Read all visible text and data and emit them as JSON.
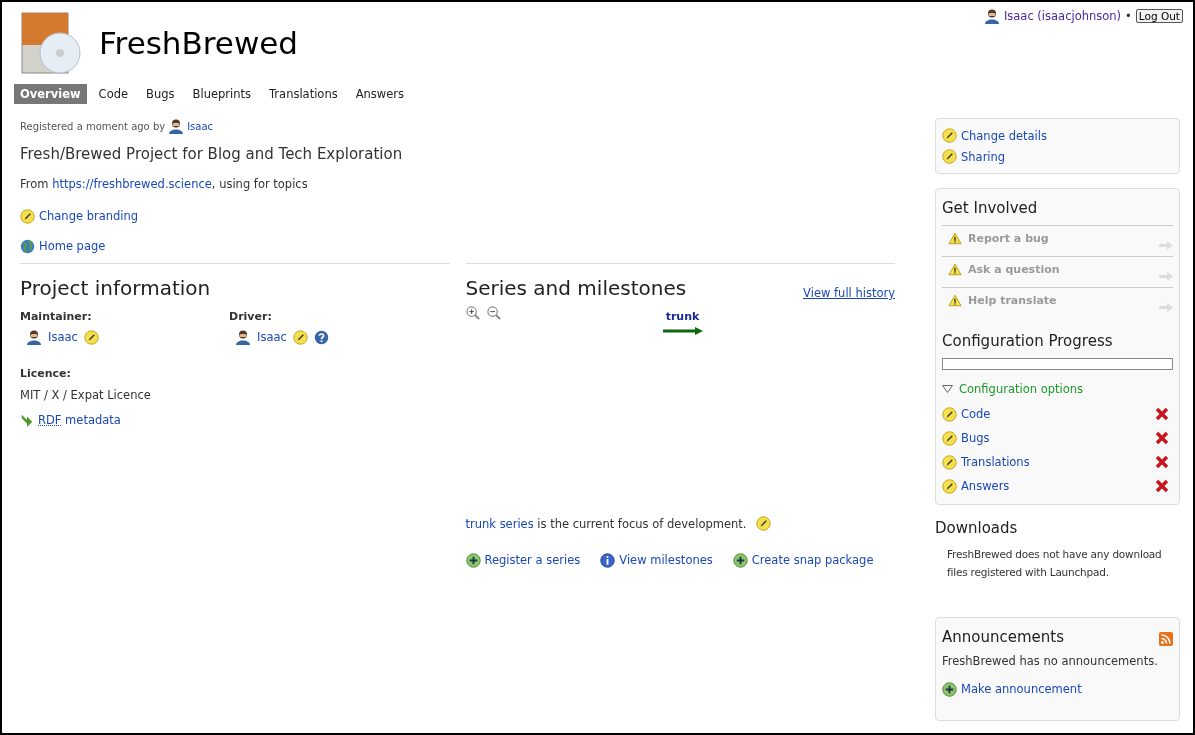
{
  "user_menu": {
    "name": "Isaac (isaacjohnson)",
    "separator": "•",
    "logout": "Log Out"
  },
  "project": {
    "title": "FreshBrewed"
  },
  "tabs": [
    {
      "label": "Overview",
      "selected": true
    },
    {
      "label": "Code",
      "selected": false
    },
    {
      "label": "Bugs",
      "selected": false
    },
    {
      "label": "Blueprints",
      "selected": false
    },
    {
      "label": "Translations",
      "selected": false
    },
    {
      "label": "Answers",
      "selected": false
    }
  ],
  "registered": {
    "text": "Registered a moment ago by",
    "user": "Isaac"
  },
  "summary": "Fresh/Brewed Project for Blog and Tech Exploration",
  "description": {
    "prefix": "From",
    "link": "https://freshbrewed.science",
    "suffix": ", using for topics"
  },
  "links": [
    {
      "label": "Change branding",
      "kind": "edit"
    },
    {
      "label": "Home page",
      "kind": "globe"
    }
  ],
  "project_information": {
    "heading": "Project information",
    "maintainer": {
      "label": "Maintainer:",
      "name": "Isaac"
    },
    "driver": {
      "label": "Driver:",
      "name": "Isaac"
    },
    "licence": {
      "label": "Licence:",
      "value": "MIT / X / Expat Licence"
    },
    "rdf": {
      "abbr": "RDF",
      "text": "metadata"
    }
  },
  "series": {
    "heading": "Series and milestones",
    "history_link": "View full history",
    "branch": "trunk",
    "focus": {
      "series": "trunk series",
      "text": "is the current focus of development."
    },
    "actions": [
      {
        "label": "Register a series",
        "kind": "add"
      },
      {
        "label": "View milestones",
        "kind": "info"
      },
      {
        "label": "Create snap package",
        "kind": "add"
      }
    ]
  },
  "sidebar": {
    "actions": [
      "Change details",
      "Sharing"
    ],
    "get_involved": {
      "heading": "Get Involved",
      "items": [
        {
          "label": "Report a bug",
          "disabled": true
        },
        {
          "label": "Ask a question",
          "disabled": true
        },
        {
          "label": "Help translate",
          "disabled": true
        }
      ]
    },
    "configuration": {
      "heading": "Configuration Progress",
      "level": 0,
      "toggle": {
        "label": "Configuration options",
        "expanded": true
      },
      "items": [
        {
          "label": "Code",
          "configured": false
        },
        {
          "label": "Bugs",
          "configured": false
        },
        {
          "label": "Translations",
          "configured": false
        },
        {
          "label": "Answers",
          "configured": false
        }
      ]
    },
    "downloads": {
      "heading": "Downloads",
      "text": "FreshBrewed does not have any download files registered with Launchpad."
    },
    "announcements": {
      "heading": "Announcements",
      "text": "FreshBrewed has no announcements.",
      "action": "Make announcement"
    }
  }
}
